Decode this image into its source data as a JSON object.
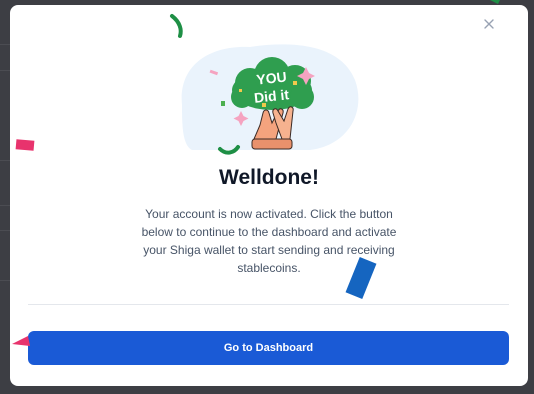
{
  "modal": {
    "title": "Welldone!",
    "body": "Your account is now activated. Click the button below to continue to the dashboard and activate your Shiga wallet to start sending and receiving stablecoins.",
    "cta_label": "Go to Dashboard",
    "illustration_text_line1": "YOU",
    "illustration_text_line2": "Did it"
  },
  "icons": {
    "close": "close-icon",
    "illustration": "high-five-illustration"
  },
  "colors": {
    "primary": "#1a5ad6",
    "title": "#101828",
    "body": "#475467",
    "badge_green": "#2f9e4f",
    "confetti_pink": "#e8336d",
    "confetti_blue": "#1565c0",
    "confetti_green": "#1e8f45",
    "overlay": "#3d3e44"
  }
}
